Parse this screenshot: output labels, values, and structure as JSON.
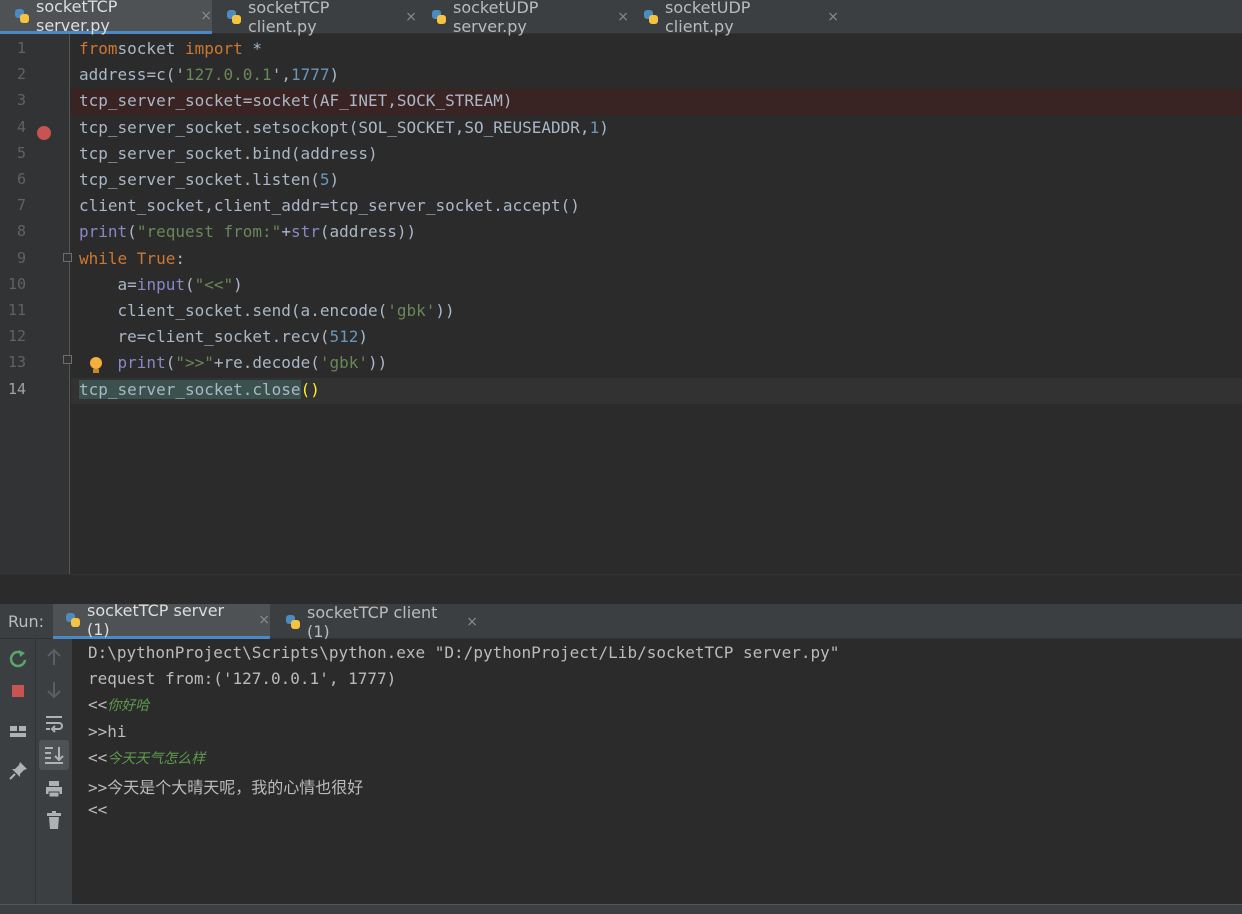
{
  "editor_tabs": [
    {
      "label": "socketTCP server.py",
      "active": true
    },
    {
      "label": "socketTCP client.py",
      "active": false
    },
    {
      "label": "socketUDP server.py",
      "active": false
    },
    {
      "label": "socketUDP client.py",
      "active": false
    }
  ],
  "close_glyph": "×",
  "line_numbers": [
    "1",
    "2",
    "3",
    "4",
    "5",
    "6",
    "7",
    "8",
    "9",
    "10",
    "11",
    "12",
    "13",
    "14"
  ],
  "code": [
    [
      [
        "kw",
        "from"
      ],
      [
        "",
        "socket "
      ],
      [
        "kw",
        "import"
      ],
      [
        "",
        " *"
      ]
    ],
    [
      [
        "",
        "address"
      ],
      [
        "",
        "="
      ],
      [
        "",
        "c('"
      ],
      [
        "str",
        "127.0.0.1"
      ],
      [
        "",
        "'"
      ],
      [
        "",
        ","
      ],
      [
        "num",
        "1777"
      ],
      [
        "",
        ")"
      ]
    ],
    [
      [
        "",
        "tcp_server_socket"
      ],
      [
        "",
        "="
      ],
      [
        "",
        "socket(AF_INET"
      ],
      [
        "",
        ","
      ],
      [
        "",
        "SOCK_STREAM)"
      ]
    ],
    [
      [
        "",
        "tcp_server_socket.setsockopt(SOL_SOCKET"
      ],
      [
        "",
        ","
      ],
      [
        "",
        "SO_REUSEADDR"
      ],
      [
        "",
        ","
      ],
      [
        "num",
        "1"
      ],
      [
        "",
        ")"
      ]
    ],
    [
      [
        "",
        "tcp_server_socket.bind(address)"
      ]
    ],
    [
      [
        "",
        "tcp_server_socket.listen("
      ],
      [
        "num",
        "5"
      ],
      [
        "",
        ")"
      ]
    ],
    [
      [
        "",
        "client_socket"
      ],
      [
        "",
        ","
      ],
      [
        "",
        "client_addr"
      ],
      [
        "",
        "="
      ],
      [
        "",
        "tcp_server_socket.accept()"
      ]
    ],
    [
      [
        "bi",
        "print"
      ],
      [
        "",
        "("
      ],
      [
        "str",
        "\"request from:\""
      ],
      [
        "",
        "+"
      ],
      [
        "bi",
        "str"
      ],
      [
        "",
        "(address))"
      ]
    ],
    [
      [
        "kw",
        "while "
      ],
      [
        "kw",
        "True"
      ],
      [
        "",
        ":"
      ]
    ],
    [
      [
        "",
        "    a"
      ],
      [
        "",
        "="
      ],
      [
        "bi",
        "input"
      ],
      [
        "",
        "("
      ],
      [
        "str",
        "\"<<\""
      ],
      [
        "",
        ")"
      ]
    ],
    [
      [
        "",
        "    client_socket.send(a.encode("
      ],
      [
        "str",
        "'gbk'"
      ],
      [
        "",
        "))"
      ]
    ],
    [
      [
        "",
        "    re"
      ],
      [
        "",
        "="
      ],
      [
        "",
        "client_socket.recv("
      ],
      [
        "num",
        "512"
      ],
      [
        "",
        ")"
      ]
    ],
    [
      [
        "",
        "    "
      ],
      [
        "bi",
        "print"
      ],
      [
        "",
        "("
      ],
      [
        "str",
        "\">>\""
      ],
      [
        "",
        "+re.decode("
      ],
      [
        "str",
        "'gbk'"
      ],
      [
        "",
        "))"
      ]
    ],
    [
      [
        "hl",
        "tcp_server_socket.close"
      ],
      [
        "pm",
        "()"
      ]
    ]
  ],
  "run": {
    "label": "Run:",
    "tabs": [
      {
        "label": "socketTCP server (1)",
        "active": true
      },
      {
        "label": "socketTCP client (1)",
        "active": false
      }
    ]
  },
  "console_lines": [
    [
      {
        "t": "D:\\pythonProject\\Scripts\\python.exe \"D:/pythonProject/Lib/socketTCP server.py\"",
        "s": "plain"
      }
    ],
    [
      {
        "t": "request from:('127.0.0.1', 1777)",
        "s": "plain"
      }
    ],
    [
      {
        "t": "<<",
        "s": "plain"
      },
      {
        "t": "你好哈",
        "s": "input"
      }
    ],
    [
      {
        "t": ">>hi",
        "s": "plain"
      }
    ],
    [
      {
        "t": "<<",
        "s": "plain"
      },
      {
        "t": "今天天气怎么样",
        "s": "input"
      }
    ],
    [
      {
        "t": ">>今天是个大晴天呢，我的心情也很好",
        "s": "plain"
      }
    ],
    [
      {
        "t": "<<",
        "s": "plain"
      }
    ]
  ],
  "toolbar_icons": {
    "left": [
      "rerun-icon",
      "stop-icon",
      "layout-icon",
      "pin-icon"
    ],
    "middle": [
      "up-arrow-icon",
      "down-arrow-icon",
      "soft-wrap-icon",
      "scroll-to-end-icon",
      "print-icon",
      "trash-icon"
    ]
  },
  "colors": {
    "background": "#2b2b2b",
    "keyword": "#cc7832",
    "string": "#6a8759",
    "number": "#6897bb",
    "builtin": "#8888c6",
    "breakpoint": "#c75450",
    "tab_accent": "#4a88c7",
    "console_input": "#5e9c4d"
  }
}
